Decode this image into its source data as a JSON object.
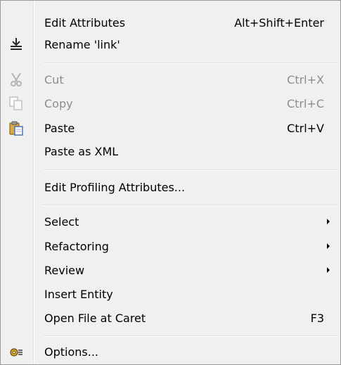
{
  "menu": {
    "edit_attributes": {
      "label": "Edit Attributes",
      "shortcut": "Alt+Shift+Enter"
    },
    "rename": {
      "label": "Rename 'link'"
    },
    "cut": {
      "label": "Cut",
      "shortcut": "Ctrl+X"
    },
    "copy": {
      "label": "Copy",
      "shortcut": "Ctrl+C"
    },
    "paste": {
      "label": "Paste",
      "shortcut": "Ctrl+V"
    },
    "paste_xml": {
      "label": "Paste as XML"
    },
    "edit_profiling": {
      "label": "Edit Profiling Attributes..."
    },
    "select": {
      "label": "Select"
    },
    "refactoring": {
      "label": "Refactoring"
    },
    "review": {
      "label": "Review"
    },
    "insert_entity": {
      "label": "Insert Entity"
    },
    "open_file": {
      "label": "Open File at Caret",
      "shortcut": "F3"
    },
    "options": {
      "label": "Options..."
    }
  },
  "icons": {
    "rename": "rename-icon",
    "cut": "scissors-icon",
    "copy": "copy-icon",
    "paste": "clipboard-icon",
    "options": "gear-icon"
  },
  "colors": {
    "background": "#f0f0f0",
    "disabled_text": "#8d8d8d",
    "border": "#9a9a9a"
  }
}
